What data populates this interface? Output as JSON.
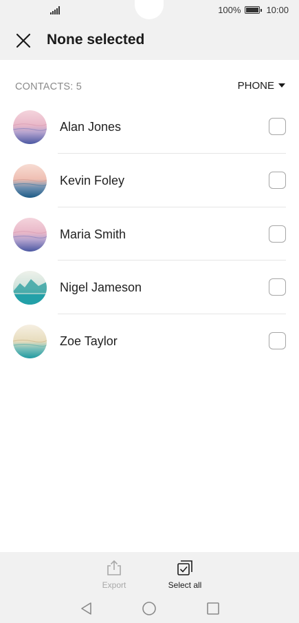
{
  "status_bar": {
    "battery_percent": "100%",
    "time": "10:00",
    "icons": [
      "signal-icon",
      "battery-icon"
    ]
  },
  "header": {
    "title": "None selected",
    "close_icon": "close-icon"
  },
  "subheader": {
    "contacts_count": "CONTACTS: 5",
    "filter_label": "PHONE",
    "filter_icon": "caret-down-icon"
  },
  "contacts": [
    {
      "name": "Alan Jones",
      "selected": false,
      "avatar": "pink-dusk-landscape"
    },
    {
      "name": "Kevin Foley",
      "selected": false,
      "avatar": "peach-sea-landscape"
    },
    {
      "name": "Maria Smith",
      "selected": false,
      "avatar": "pink-dusk-landscape"
    },
    {
      "name": "Nigel Jameson",
      "selected": false,
      "avatar": "teal-mountain-lake"
    },
    {
      "name": "Zoe Taylor",
      "selected": false,
      "avatar": "cream-teal-sea"
    }
  ],
  "toolbar": {
    "export_label": "Export",
    "export_icon": "share-upload-icon",
    "export_enabled": false,
    "select_all_label": "Select all",
    "select_all_icon": "select-all-icon"
  },
  "nav": {
    "back_icon": "back-triangle-icon",
    "home_icon": "home-circle-icon",
    "recent_icon": "recent-square-icon"
  },
  "colors": {
    "header_bg": "#f1f1f1",
    "text_primary": "#1f1f1f",
    "text_secondary": "#8a8a8a",
    "disabled": "#a8a8a8",
    "checkbox_border": "#a6a6a6"
  }
}
